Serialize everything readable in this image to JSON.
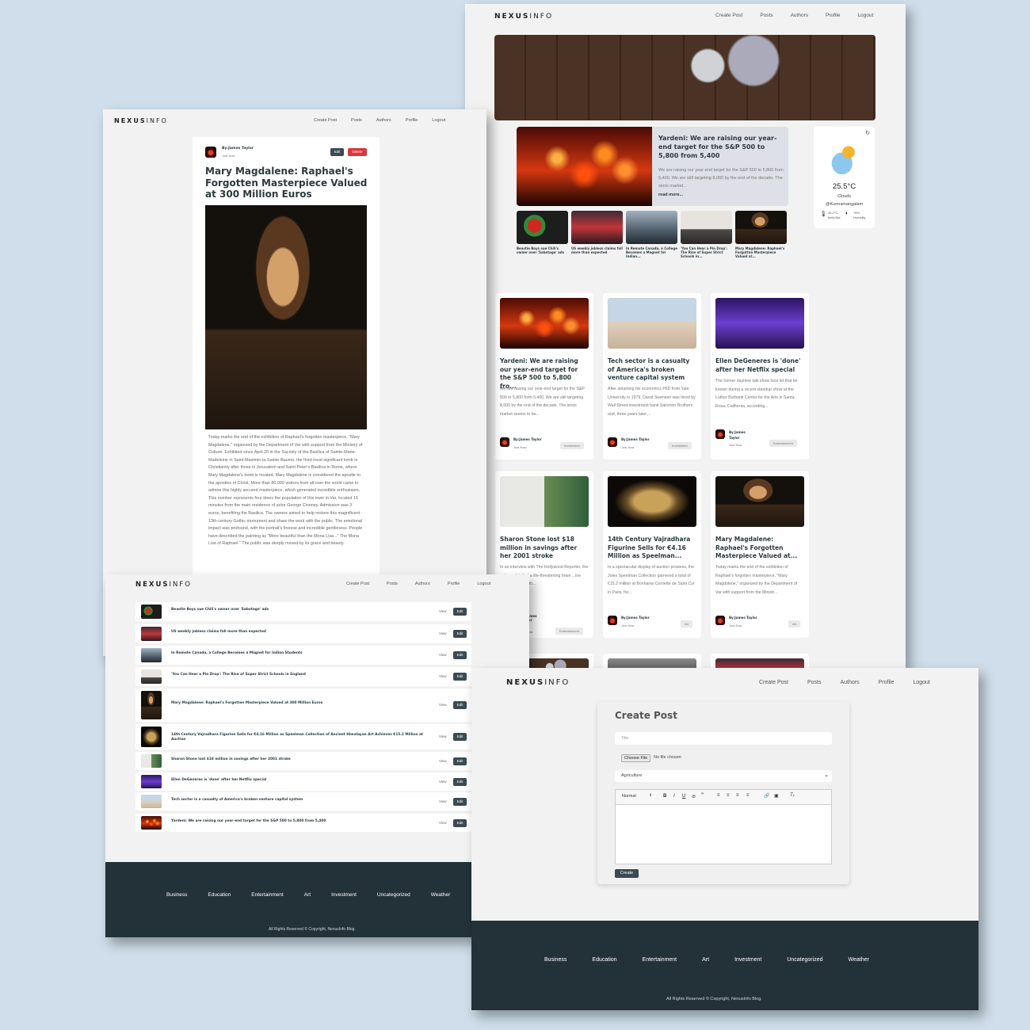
{
  "brand": {
    "part1": "NEXUS",
    "part2": "INFO"
  },
  "nav": {
    "create_post": "Create Post",
    "posts": "Posts",
    "authors": "Authors",
    "profile": "Profile",
    "logout": "Logout"
  },
  "home": {
    "featured": {
      "title": "Yardeni: We are raising our year-end target for the S&P 500 to 5,800 from 5,400",
      "excerpt": "We are raising our year-end target for the S&P 500 to 5,800 from 5,400. We are still targeting 8,000 by the end of the decade. The stock market...",
      "read_more": "read more..."
    },
    "weather": {
      "temp": "25.5°C",
      "desc": "Clouds",
      "location": "@Kunnamangalam",
      "feels": "26.2°C",
      "feels_label": "feels like",
      "humidity": "78%",
      "humidity_label": "Humidity"
    },
    "thumbs": [
      {
        "title": "Beastie Boys sue Chili's owner over 'Sabotage' ads"
      },
      {
        "title": "US weekly jobless claims fall more than expected"
      },
      {
        "title": "In Remote Canada, a College Becomes a Magnet for Indian..."
      },
      {
        "title": "'You Can Hear a Pin Drop': The Rise of Super Strict Schools in..."
      },
      {
        "title": "Mary Magdalene: Raphael's Forgotten Masterpiece Valued at..."
      }
    ],
    "cards": [
      {
        "title": "Yardeni: We are raising our year-end target for the S&P 500 to 5,800 fro...",
        "excerpt": "We are raising our year-end target for the S&P 500 to 5,800 from 5,400. We are still targeting 8,000 by the end of the decade. The stock market seems to be...",
        "author": "By:James Taylor",
        "time": "Just Now",
        "tag": "Investment"
      },
      {
        "title": "Tech sector is a casualty of America's broken venture capital system",
        "excerpt": "After obtaining his economics PhD from Yale University in 1979, David Swensen was hired by Wall Street investment bank Salomon Brothers and, three years later,...",
        "author": "By:James Taylor",
        "time": "Just Now",
        "tag": "Investment"
      },
      {
        "title": "Ellen DeGeneres is 'done' after her Netflix special",
        "excerpt": "The former daytime talk show host let that be known during a recent standup show at the Luther Burbank Center for the Arts in Santa Rosa, California, according...",
        "author": "By:James Taylor",
        "time": "Just Now",
        "tag": "Entertainment"
      },
      {
        "title": "Sharon Stone lost $18 million in savings after her 2001 stroke",
        "excerpt": "In an interview with The Hollywood Reporter, the actress detailed a life-threatening brain ...ine days and a length...",
        "author": "...ames ...lor",
        "time": "...Now",
        "tag": "Entertainment"
      },
      {
        "title": "14th Century Vajradhara Figurine Sells for €4.16 Million as Speelman...",
        "excerpt": "In a spectacular display of auction prowess, the Jules Speelman Collection garnered a total of €15.2 million at Bonhams Cornette de Saint Cyr in Paris, for...",
        "author": "By:James Taylor",
        "time": "Just Now",
        "tag": "Art"
      },
      {
        "title": "Mary Magdalene: Raphael's Forgotten Masterpiece Valued at...",
        "excerpt": "Today marks the end of the exhibition of Raphael's forgotten masterpiece, \"Mary Magdolene,\" organized by the Department of Var with support from the Ministr...",
        "author": "By:James Taylor",
        "time": "Just Now",
        "tag": "Art"
      }
    ]
  },
  "article": {
    "author": "By:James Taylor",
    "time": "Just Now",
    "edit": "Edit",
    "delete": "Delete",
    "title": "Mary Magdalene: Raphael's Forgotten Masterpiece Valued at 300 Million Euros",
    "body": "Today marks the end of the exhibition of Raphael's forgotten masterpiece, \"Mary Magdalene,\" organized by the Department of Var with support from the Ministry of Culture. Exhibited since April 20 in the Sacristy of the Basilica of Sainte-Marie-Madeleine in Saint-Maximin-la-Sainte-Baume, the third most significant tomb in Christianity after those in Jerusalem and Saint Peter's Basilica in Rome, where Mary Magdalene's tomb is located. Mary Magdalene is considered the apostle to the apostles of Christ. More than 80,000 visitors from all over the world came to admire this highly secured masterpiece, which generated incredible enthusiasm. This number represents four times the population of this town in Var, located 15 minutes from the main residence of actor George Clooney. Admission was 3 euros, benefiting the Basilica. The owners aimed to help restore this magnificent 13th-century Gothic monument and share the work with the public. The emotional impact was profound, with the portrait's finesse and incredible gentleness. People have described the painting as \"More beautiful than the Mona Lisa...\" The Mona Lisa of Raphael.\" The public was deeply moved by its grace and beauty."
  },
  "posts_list": {
    "view": "View",
    "edit": "Edit",
    "delete": "Delete",
    "rows": [
      {
        "title": "Beastie Boys sue Chili's owner over 'Sabotage' ads",
        "del": true
      },
      {
        "title": "US weekly jobless claims fall more than expected",
        "del": true
      },
      {
        "title": "In Remote Canada, a College Becomes a Magnet for Indian Students",
        "del": true
      },
      {
        "title": "'You Can Hear a Pin Drop': The Rise of Super Strict Schools in England",
        "del": false
      },
      {
        "title": "Mary Magdalene: Raphael's Forgotten Masterpiece Valued at 300 Million Euros",
        "del": false
      },
      {
        "title": "14th Century Vajradhara Figurine Sells for €4.16 Million as Speelman Collection of Ancient Himalayan Art Achieves €15.2 Million at Auction",
        "del": false
      },
      {
        "title": "Sharon Stone lost $18 million in savings after her 2001 stroke",
        "del": false
      },
      {
        "title": "Ellen DeGeneres is 'done' after her Netflix special",
        "del": false
      },
      {
        "title": "Tech sector is a casualty of America's broken venture capital system",
        "del": false
      },
      {
        "title": "Yardeni: We are raising our year-end target for the S&P 500 to 5,800 from 5,400",
        "del": false
      }
    ]
  },
  "create": {
    "heading": "Create Post",
    "title_placeholder": "Title",
    "choose_file": "Choose File",
    "no_file": "No file chosen",
    "category": "Agriculture",
    "format": "Normal",
    "submit": "Create"
  },
  "footer": {
    "categories": [
      "Business",
      "Education",
      "Entertainment",
      "Art",
      "Investment",
      "Uncategorized",
      "Weather"
    ],
    "copyright": "All Rights Reserved © Copyright, NexusInfo Blog."
  }
}
